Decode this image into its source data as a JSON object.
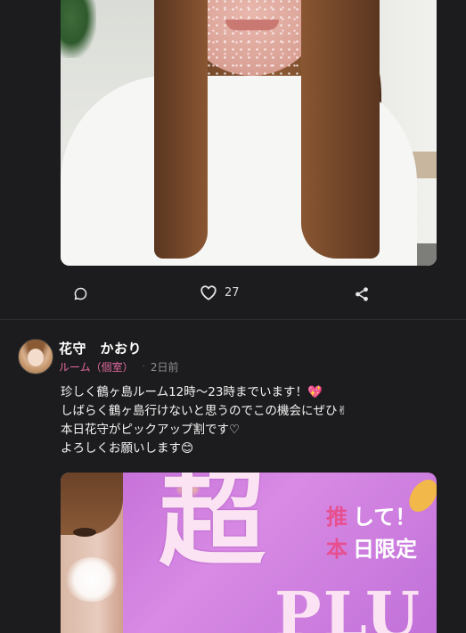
{
  "post1": {
    "like_count": "27"
  },
  "post2": {
    "author": "花守　かおり",
    "category": "ルーム（個室）",
    "separator": "·",
    "time": "2日前",
    "body_lines": [
      "珍しく鶴ヶ島ルーム12時〜23時までいます！💖",
      "しばらく鶴ヶ島行けないと思うのでこの機会にぜひ✌",
      "本日花守がピックアップ割です♡",
      "よろしくお願いします😊"
    ],
    "banner": {
      "big_char": "超",
      "tag_a": "推",
      "tag_a_rest": "して！",
      "tag_b": "本",
      "tag_b_rest": "日限定",
      "big_word": "PLU"
    }
  },
  "colors": {
    "background": "#1c1c1e",
    "accent_pink": "#e36aa0",
    "text_primary": "#ffffff",
    "text_secondary": "#8e8e93"
  },
  "icons": {
    "comment": "comment-icon",
    "like": "heart-icon",
    "share": "share-icon"
  }
}
